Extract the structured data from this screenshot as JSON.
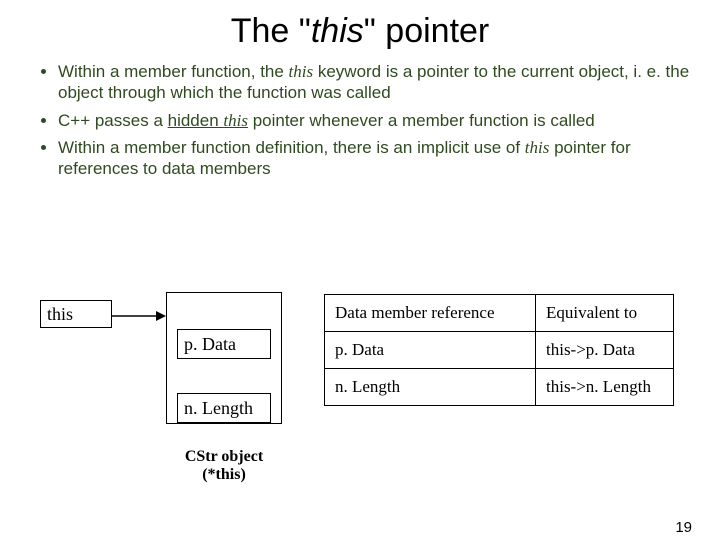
{
  "title": {
    "pre": "The \"",
    "kw": "this",
    "post": "\" pointer"
  },
  "bullets": [
    {
      "segments": [
        "Within a member function, the ",
        {
          "kw": "this"
        },
        " keyword is a pointer to the current object, i. e. the object through which the function was called"
      ]
    },
    {
      "segments": [
        "C++ passes a ",
        {
          "kw": "this",
          "underline": true
        },
        {
          "underline_plain": " hidden "
        },
        " pointer whenever a member function is called"
      ]
    },
    {
      "segments": [
        "Within a member function definition, there is an implicit use of ",
        {
          "kw": "this"
        },
        " pointer for references to data members"
      ]
    }
  ],
  "bullets_plain": [
    "",
    "",
    ""
  ],
  "bullet2_pre": "C++ passes a ",
  "bullet2_hidden": "hidden ",
  "bullet2_this": "this",
  "bullet2_post": " pointer whenever a member function is called",
  "bullet1_pre": "Within a member function, the ",
  "bullet1_kw": "this",
  "bullet1_post": " keyword is a pointer to the current object, i. e. the object through which the function was called",
  "bullet3_pre": "Within a member function definition, there is an implicit use of ",
  "bullet3_kw": "this",
  "bullet3_post": " pointer for references to data members",
  "diagram": {
    "this_label": "this",
    "member_p": "p. Data",
    "member_n": "n. Length",
    "caption_line1": "CStr object",
    "caption_line2": "(*this)"
  },
  "table": {
    "headers": [
      "Data member reference",
      "Equivalent to"
    ],
    "rows": [
      [
        "p. Data",
        "this->p. Data"
      ],
      [
        "n. Length",
        "this->n. Length"
      ]
    ]
  },
  "page_number": "19"
}
